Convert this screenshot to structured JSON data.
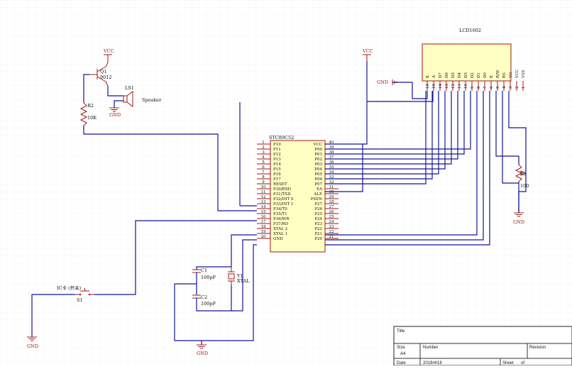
{
  "colors": {
    "wire": "#15159a",
    "component": "#a01818",
    "chip_fill": "#ffffc4",
    "grid": "#eeeeee"
  },
  "labels": {
    "vcc": "VCC",
    "gnd": "GND",
    "q1_ref": "Q1",
    "q1_val": "9012",
    "r2_ref": "R2",
    "r2_val": "10K",
    "ls1_ref": "LS1",
    "ls1_val": "Speaker",
    "ic_name": "STC89C52",
    "lcd_name": "LCD1602",
    "pot_ref": "R2",
    "pot_val": "100",
    "c1_ref": "C1",
    "c1_val": "100pF",
    "c2_ref": "C2",
    "c2_val": "100pF",
    "y1_ref": "Y1",
    "y1_val": "XTAL",
    "s1_title": "IC卡 (开关)",
    "s1_ref": "S1"
  },
  "mcu": {
    "left_pins": [
      {
        "num": "1",
        "name": "P10"
      },
      {
        "num": "2",
        "name": "P11"
      },
      {
        "num": "3",
        "name": "P12"
      },
      {
        "num": "4",
        "name": "P13"
      },
      {
        "num": "5",
        "name": "P14"
      },
      {
        "num": "6",
        "name": "P15"
      },
      {
        "num": "7",
        "name": "P16"
      },
      {
        "num": "8",
        "name": "P17"
      },
      {
        "num": "9",
        "name": "RESET"
      },
      {
        "num": "10",
        "name": "P30/RXD"
      },
      {
        "num": "11",
        "name": "P31/TXD"
      },
      {
        "num": "12",
        "name": "P32/INT 0"
      },
      {
        "num": "13",
        "name": "P33/INT 1"
      },
      {
        "num": "14",
        "name": "P34/T0"
      },
      {
        "num": "15",
        "name": "P35/T1"
      },
      {
        "num": "16",
        "name": "P36/WR"
      },
      {
        "num": "17",
        "name": "P37/RD"
      },
      {
        "num": "18",
        "name": "XTAL 2"
      },
      {
        "num": "19",
        "name": "XTAL 1"
      },
      {
        "num": "20",
        "name": "GND"
      }
    ],
    "right_pins": [
      {
        "num": "40",
        "name": "VCC"
      },
      {
        "num": "39",
        "name": "P00"
      },
      {
        "num": "38",
        "name": "P01"
      },
      {
        "num": "37",
        "name": "P02"
      },
      {
        "num": "36",
        "name": "P03"
      },
      {
        "num": "35",
        "name": "P04"
      },
      {
        "num": "34",
        "name": "P05"
      },
      {
        "num": "33",
        "name": "P06"
      },
      {
        "num": "32",
        "name": "P07"
      },
      {
        "num": "31",
        "name": "EA"
      },
      {
        "num": "30",
        "name": "ALE"
      },
      {
        "num": "29",
        "name": "PSEN"
      },
      {
        "num": "28",
        "name": "P27"
      },
      {
        "num": "27",
        "name": "P26"
      },
      {
        "num": "26",
        "name": "P25"
      },
      {
        "num": "25",
        "name": "P24"
      },
      {
        "num": "24",
        "name": "P23"
      },
      {
        "num": "23",
        "name": "P22"
      },
      {
        "num": "22",
        "name": "P21"
      },
      {
        "num": "21",
        "name": "P20"
      }
    ]
  },
  "lcd": {
    "pins": [
      {
        "num": "16",
        "name": "K"
      },
      {
        "num": "15",
        "name": "A"
      },
      {
        "num": "14",
        "name": "D7"
      },
      {
        "num": "13",
        "name": "D6"
      },
      {
        "num": "12",
        "name": "D5"
      },
      {
        "num": "11",
        "name": "D4"
      },
      {
        "num": "10",
        "name": "D3"
      },
      {
        "num": "9",
        "name": "D2"
      },
      {
        "num": "8",
        "name": "D1"
      },
      {
        "num": "7",
        "name": "D0"
      },
      {
        "num": "6",
        "name": "E"
      },
      {
        "num": "5",
        "name": "R/W"
      },
      {
        "num": "4",
        "name": "RS"
      },
      {
        "num": "3",
        "name": "VO"
      },
      {
        "num": "2",
        "name": "VCC"
      },
      {
        "num": "1",
        "name": "VSS"
      }
    ]
  },
  "title_block": {
    "title_label": "Title",
    "size_label": "Size",
    "size_value": "A4",
    "number_label": "Number",
    "revision_label": "Revision",
    "date_label": "Date",
    "date_value": "2019/4/18",
    "sheet_label": "Sheet",
    "of_label": "of"
  }
}
